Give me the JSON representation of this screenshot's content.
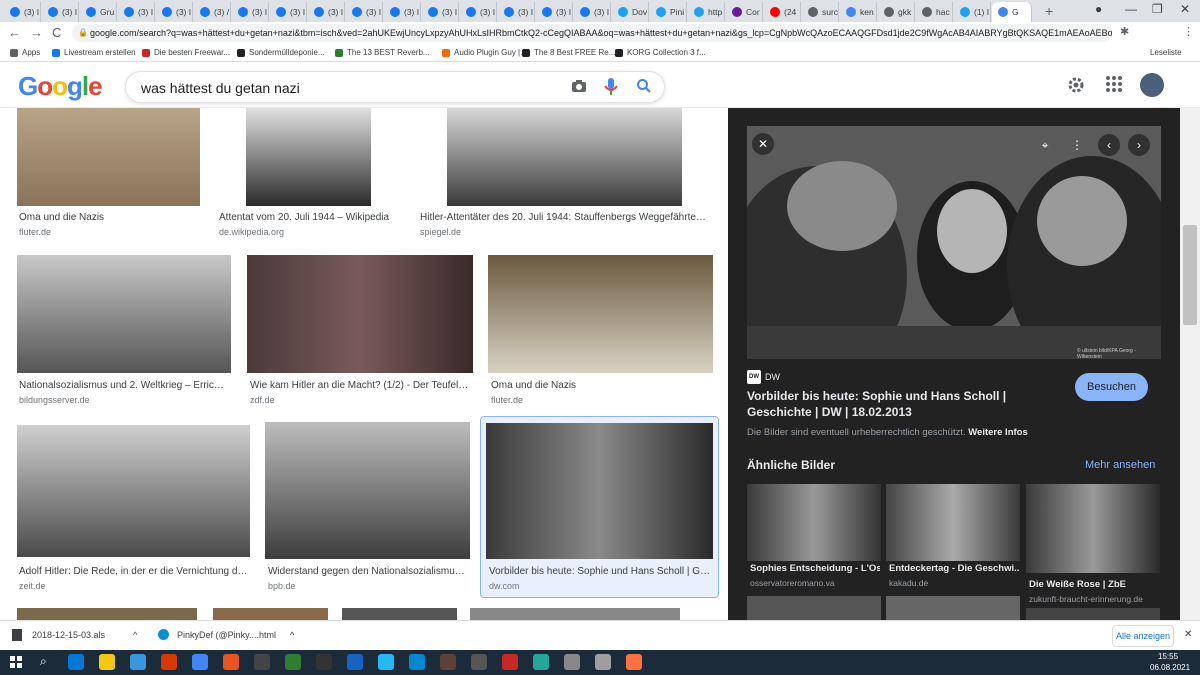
{
  "tabs": [
    {
      "label": "(3) I",
      "color": "#1877f2"
    },
    {
      "label": "(3) I",
      "color": "#1877f2"
    },
    {
      "label": "Gru",
      "color": "#1877f2"
    },
    {
      "label": "(3) I",
      "color": "#1877f2"
    },
    {
      "label": "(3) I",
      "color": "#1877f2"
    },
    {
      "label": "(3) /",
      "color": "#1877f2"
    },
    {
      "label": "(3) I",
      "color": "#1877f2"
    },
    {
      "label": "(3) I",
      "color": "#1877f2"
    },
    {
      "label": "(3) I",
      "color": "#1877f2"
    },
    {
      "label": "(3) I",
      "color": "#1877f2"
    },
    {
      "label": "(3) I",
      "color": "#1877f2"
    },
    {
      "label": "(3) I",
      "color": "#1877f2"
    },
    {
      "label": "(3) I",
      "color": "#1877f2"
    },
    {
      "label": "(3) I",
      "color": "#1877f2"
    },
    {
      "label": "(3) I",
      "color": "#1877f2"
    },
    {
      "label": "(3) I",
      "color": "#1877f2"
    },
    {
      "label": "Dov",
      "color": "#1da1f2"
    },
    {
      "label": "Pini",
      "color": "#1da1f2"
    },
    {
      "label": "http",
      "color": "#1da1f2"
    },
    {
      "label": "Cor",
      "color": "#6a1b9a"
    },
    {
      "label": "(24",
      "color": "#ff0000"
    },
    {
      "label": "surc",
      "color": "#5f6368"
    },
    {
      "label": "ken",
      "color": "#4285f4"
    },
    {
      "label": "gkk",
      "color": "#5f6368"
    },
    {
      "label": "hac",
      "color": "#5f6368"
    },
    {
      "label": "(1) I",
      "color": "#1da1f2"
    },
    {
      "label": "G",
      "color": "#4285f4"
    }
  ],
  "window": {
    "minimize": "—",
    "maximize": "❐",
    "close": "✕",
    "new_tab": "+",
    "record": "●"
  },
  "url": "google.com/search?q=was+hättest+du+getan+nazi&tbm=isch&ved=2ahUKEwjUncyLxpzyAhUHxLsIHRbmCtkQ2-cCegQIABAA&oq=was+hättest+du+getan+nazi&gs_lcp=CgNpbWcQAzoECAAQGFDsd1jde2C9fWgAcAB4AIABRYgBtQKSAQE1mAEAoAEBqgEL...",
  "nav": {
    "back": "←",
    "forward": "→",
    "reload": "C",
    "lock": "🔒"
  },
  "bookmarks": [
    {
      "label": "Apps",
      "color": "#5f6368"
    },
    {
      "label": "Livestream erstellen",
      "color": "#1877f2"
    },
    {
      "label": "Die besten Freewar...",
      "color": "#c62828"
    },
    {
      "label": "Sondermülldeponie...",
      "color": "#202124"
    },
    {
      "label": "The 13 BEST Reverb...",
      "color": "#2e7d32"
    },
    {
      "label": "Audio Plugin Guy |...",
      "color": "#ef6c00"
    },
    {
      "label": "The 8 Best FREE Re...",
      "color": "#202124"
    },
    {
      "label": "KORG Collection 3 f...",
      "color": "#202124"
    }
  ],
  "reading_list": "Leseliste",
  "search": {
    "query": "was hättest du getan nazi",
    "logo": "Google"
  },
  "logo_colors": [
    "#4285f4",
    "#ea4335",
    "#fbbc05",
    "#4285f4",
    "#34a853",
    "#ea4335"
  ],
  "results": {
    "row1": [
      {
        "title": "Oma und die Nazis",
        "source": "fluter.de"
      },
      {
        "title": "Attentat vom 20. Juli 1944 – Wikipedia",
        "source": "de.wikipedia.org"
      },
      {
        "title": "Hitler-Attentäter des 20. Juli 1944: Stauffenbergs Weggefährten - ...",
        "source": "spiegel.de"
      }
    ],
    "row2": [
      {
        "title": "Nationalsozialismus und 2. Weltkrieg – Erricht...",
        "source": "bildungsserver.de"
      },
      {
        "title": "Wie kam Hitler an die Macht? (1/2) - Der Teufelsp...",
        "source": "zdf.de"
      },
      {
        "title": "Oma und die Nazis",
        "source": "fluter.de"
      }
    ],
    "row3": [
      {
        "title": "Adolf Hitler: Die Rede, in der er die Vernichtung der ...",
        "source": "zeit.de"
      },
      {
        "title": "Widerstand gegen den Nationalsozialismus |...",
        "source": "bpb.de"
      },
      {
        "title": "Vorbilder bis heute: Sophie und Hans Scholl | Ges...",
        "source": "dw.com"
      }
    ]
  },
  "preview": {
    "source": "DW",
    "title": "Vorbilder bis heute: Sophie und Hans Scholl | Geschichte | DW | 18.02.2013",
    "visit": "Besuchen",
    "copyright": "Die Bilder sind eventuell urheberrechtlich geschützt.",
    "more_info": "Weitere Infos",
    "similar_heading": "Ähnliche Bilder",
    "see_more": "Mehr ansehen",
    "watermark": "© ullstein bild/KPA Georg - Wittenstein",
    "similar": [
      {
        "title": "Sophies Entscheidung - L'Os...",
        "source": "osservatoreromano.va"
      },
      {
        "title": "Entdeckertag - Die Geschwi...",
        "source": "kakadu.de"
      },
      {
        "title": "Die Weiße Rose | ZbE",
        "source": "zukunft-braucht-erinnerung.de"
      }
    ]
  },
  "downloads": [
    {
      "name": "2018-12-15-03.als"
    },
    {
      "name": "PinkyDef (@Pinky....html"
    }
  ],
  "show_all": "Alle anzeigen",
  "clock": {
    "time": "15:55",
    "date": "06.08.2021"
  }
}
